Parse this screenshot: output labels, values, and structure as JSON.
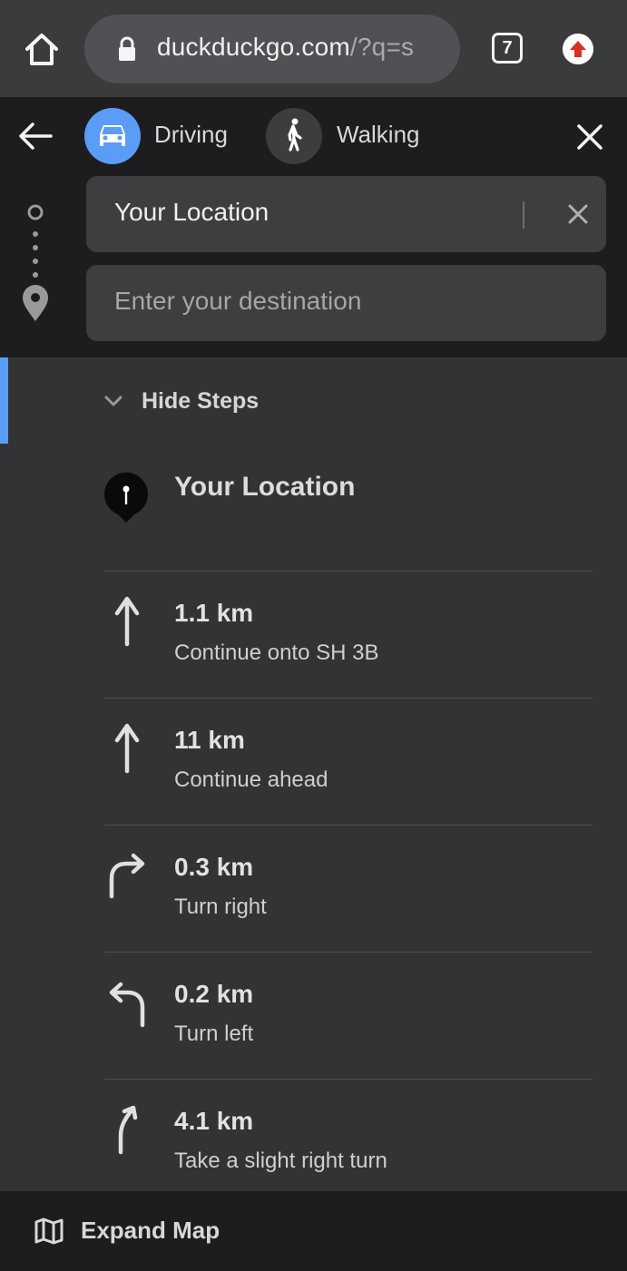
{
  "browser": {
    "url_main": "duckduckgo.com",
    "url_rest": "/?q=s",
    "tab_count": "7"
  },
  "directions": {
    "modes": [
      {
        "label": "Driving",
        "icon": "car-icon",
        "active": true
      },
      {
        "label": "Walking",
        "icon": "walking-person-icon",
        "active": false
      }
    ],
    "from_value": "Your Location",
    "to_placeholder": "Enter your destination"
  },
  "steps": {
    "toggle_label": "Hide Steps",
    "origin": "Your Location",
    "items": [
      {
        "distance": "1.1 km",
        "instruction": "Continue onto SH 3B",
        "icon": "arrow-straight-icon"
      },
      {
        "distance": "11 km",
        "instruction": "Continue ahead",
        "icon": "arrow-straight-icon"
      },
      {
        "distance": "0.3 km",
        "instruction": "Turn right",
        "icon": "turn-right-icon"
      },
      {
        "distance": "0.2 km",
        "instruction": "Turn left",
        "icon": "turn-left-icon"
      },
      {
        "distance": "4.1 km",
        "instruction": "Take a slight right turn",
        "icon": "slight-right-icon"
      }
    ]
  },
  "footer": {
    "expand_label": "Expand Map",
    "icon": "map-icon"
  },
  "colors": {
    "accent": "#5b9cf7",
    "header_bg": "#1d1d1f",
    "panel_bg": "#333335",
    "update_red": "#d93025"
  }
}
